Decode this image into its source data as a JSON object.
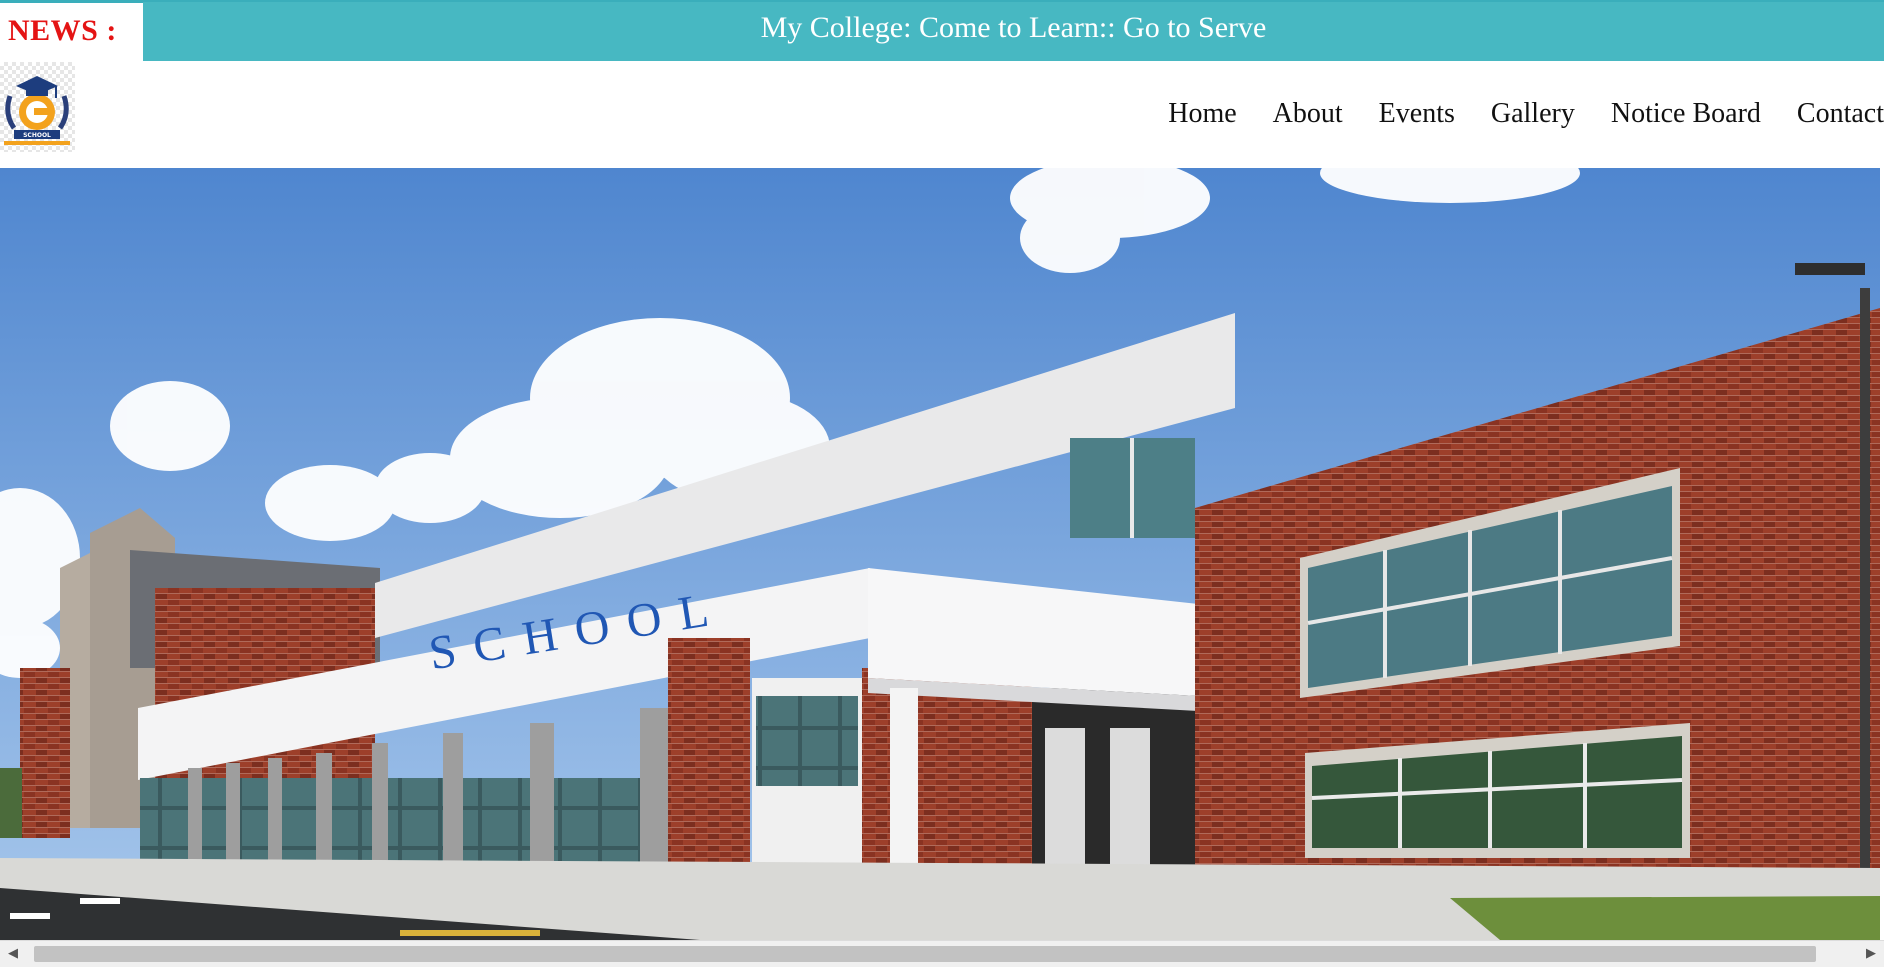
{
  "news": {
    "label": "NEWS :",
    "ticker_text": "My College: Come to Learn:: Go to Serve"
  },
  "logo": {
    "icon": "graduation-cap-school-emblem",
    "text": "SCHOOL"
  },
  "nav": {
    "items": [
      {
        "label": "Home"
      },
      {
        "label": "About"
      },
      {
        "label": "Events"
      },
      {
        "label": "Gallery"
      },
      {
        "label": "Notice Board"
      },
      {
        "label": "Contact"
      }
    ]
  },
  "hero": {
    "building_sign": "SCHOOL"
  },
  "scrollbar": {
    "left_arrow": "◀",
    "right_arrow": "▶"
  },
  "colors": {
    "ticker_bg": "#47b8c2",
    "news_label": "#e41414",
    "brick": "#9a3b27",
    "sky": "#6b9fd6"
  }
}
